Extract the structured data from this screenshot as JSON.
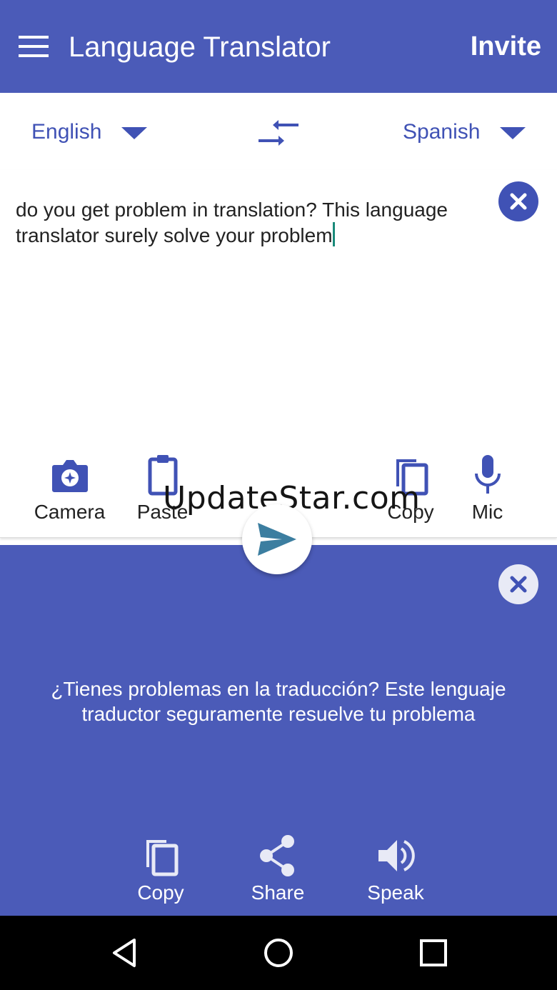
{
  "app": {
    "title": "Language Translator",
    "invite_label": "Invite"
  },
  "languages": {
    "from": "English",
    "to": "Spanish"
  },
  "input": {
    "text": "do you get problem in translation? This language translator surely solve your problem"
  },
  "input_tools": {
    "camera": "Camera",
    "paste": "Paste",
    "copy": "Copy",
    "mic": "Mic"
  },
  "watermark": "UpdateStar.com",
  "output": {
    "text": "¿Tienes problemas en la traducción? Este lenguaje traductor seguramente resuelve tu problema"
  },
  "output_tools": {
    "copy": "Copy",
    "share": "Share",
    "speak": "Speak"
  },
  "colors": {
    "primary": "#4b5bb8",
    "accent_text": "#4052b5",
    "send_icon": "#3c7ea0",
    "cursor": "#1a8a7a"
  },
  "icons": [
    "menu-icon",
    "swap-icon",
    "close-icon",
    "camera-icon",
    "paste-icon",
    "copy-icon",
    "mic-icon",
    "send-icon",
    "share-icon",
    "speaker-icon",
    "back-icon",
    "home-icon",
    "recents-icon"
  ]
}
